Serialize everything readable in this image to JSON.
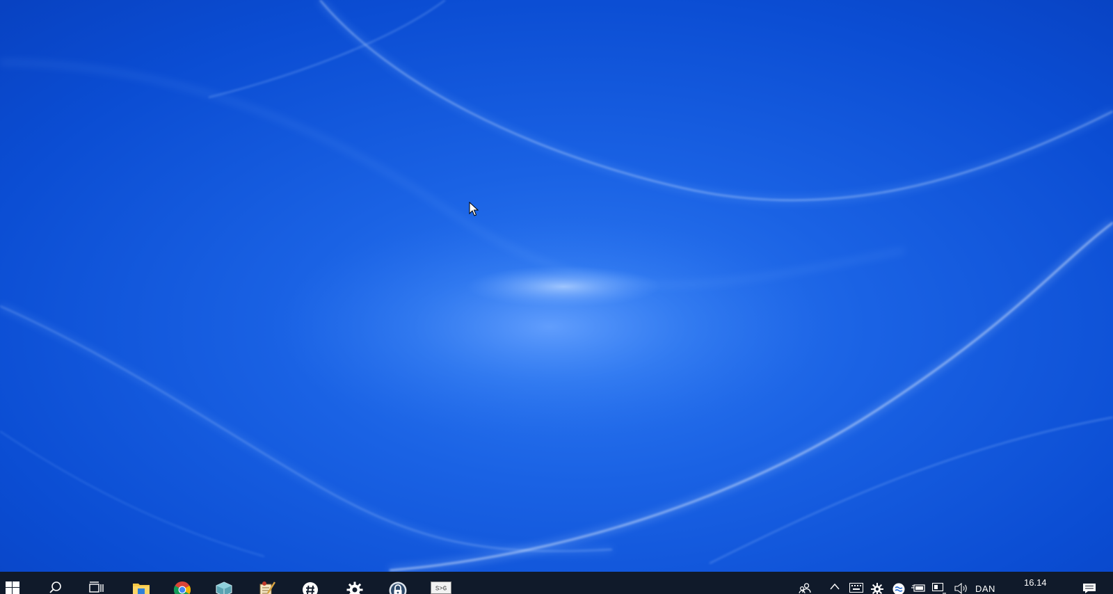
{
  "taskbar": {
    "start_icon": "windows-logo-icon",
    "search_icon": "search-icon",
    "task_view_icon": "task-view-icon",
    "pinned_apps": [
      {
        "name": "file-explorer",
        "icon": "folder-icon"
      },
      {
        "name": "chrome",
        "icon": "chrome-icon"
      },
      {
        "name": "virtualbox",
        "icon": "virtualbox-cube-icon"
      },
      {
        "name": "editor",
        "icon": "notepad-pen-icon"
      },
      {
        "name": "slack",
        "icon": "slack-hash-icon"
      },
      {
        "name": "settings",
        "icon": "gear-icon"
      },
      {
        "name": "keepass",
        "icon": "lock-icon"
      },
      {
        "name": "terminal",
        "icon": "terminal-icon"
      }
    ],
    "terminal_label": "S>G"
  },
  "tray": {
    "people_icon": "people-icon",
    "show_hidden_icon": "chevron-up-icon",
    "keyboard_icon": "keyboard-icon",
    "bug_icon": "gear-tray-icon",
    "ferdi_icon": "waves-icon",
    "power_icon": "power-plug-icon",
    "network_icon": "network-icon",
    "volume_icon": "speaker-icon",
    "language": "DAN",
    "time": "16.14",
    "notifications_icon": "action-center-icon"
  },
  "colors": {
    "wallpaper_base": "#0a4fd6",
    "taskbar_bg": "#101a2a",
    "chrome_red": "#db4437",
    "chrome_yellow": "#f4b400",
    "chrome_green": "#0f9d58",
    "chrome_blue": "#4285f4",
    "folder_yellow": "#f8c845",
    "virtualbox_teal": "#5aa3b2"
  }
}
